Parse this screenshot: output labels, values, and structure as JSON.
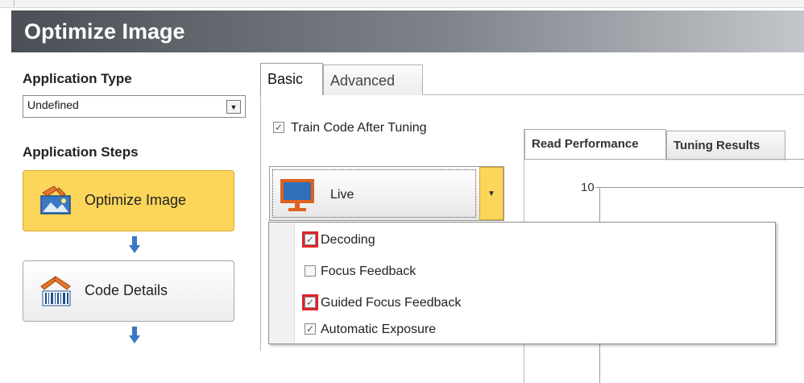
{
  "window": {
    "title": "Optimize Image"
  },
  "left": {
    "application_type_label": "Application Type",
    "application_type_value": "Undefined",
    "application_steps_label": "Application Steps",
    "steps": [
      {
        "label": "Optimize Image",
        "icon": "optimize-image-icon",
        "active": true
      },
      {
        "label": "Code Details",
        "icon": "code-details-icon",
        "active": false
      }
    ]
  },
  "tabs": [
    {
      "label": "Basic",
      "selected": true
    },
    {
      "label": "Advanced",
      "selected": false
    }
  ],
  "basic": {
    "train_code_label": "Train Code After Tuning",
    "train_code_checked": true,
    "live_button_label": "Live"
  },
  "inner_tabs": [
    {
      "label": "Read Performance",
      "selected": true
    },
    {
      "label": "Tuning Results",
      "selected": false
    }
  ],
  "chart": {
    "y_tick_top": "10"
  },
  "live_menu": {
    "items": [
      {
        "label": "Decoding",
        "checked": true,
        "highlighted": true
      },
      {
        "label": "Focus Feedback",
        "checked": false,
        "highlighted": false
      },
      {
        "label": "Guided Focus Feedback",
        "checked": true,
        "highlighted": true
      },
      {
        "label": "Automatic Exposure",
        "checked": true,
        "highlighted": false
      }
    ]
  },
  "colors": {
    "active_step": "#fbd65a",
    "highlight_outline": "#e0242a",
    "arrow_blue": "#3a78c3",
    "header_dark": "#4a4f56"
  }
}
